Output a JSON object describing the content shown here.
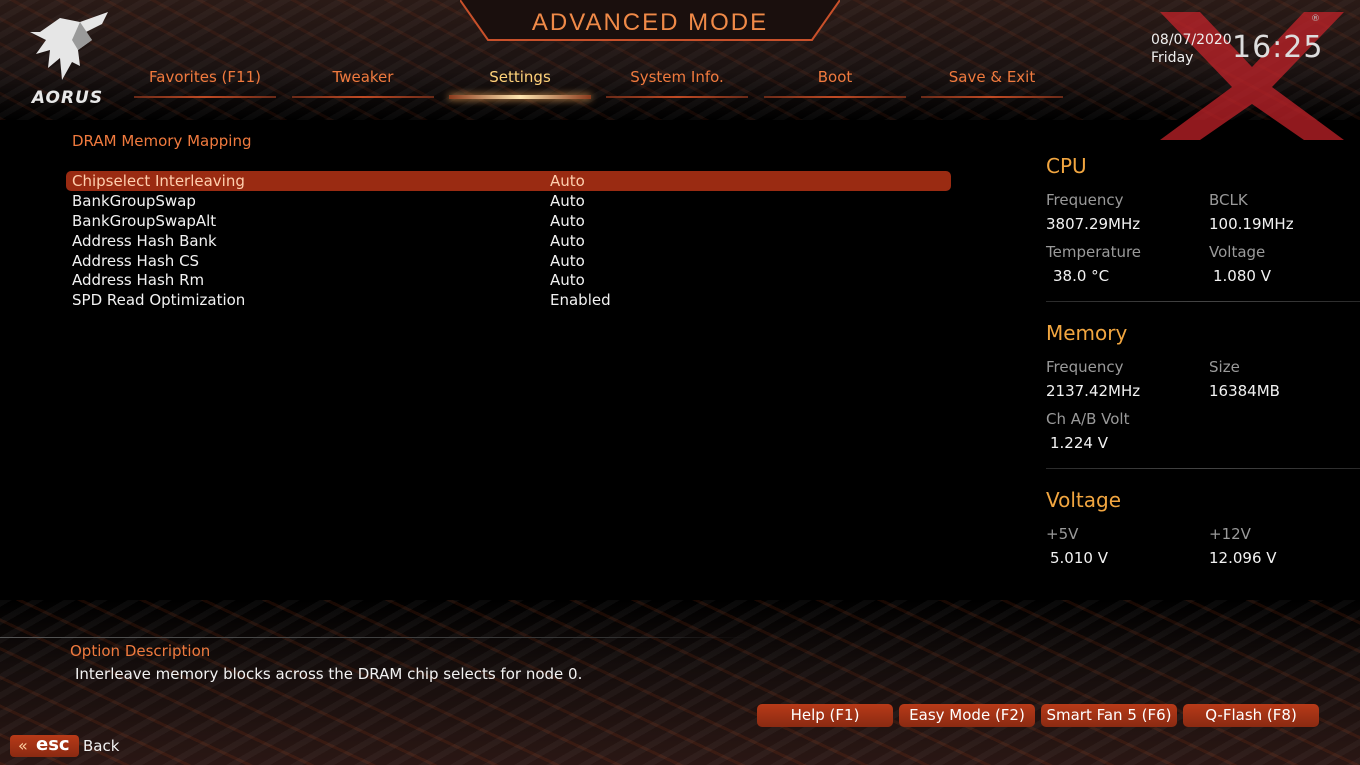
{
  "header": {
    "title": "ADVANCED MODE",
    "logo_text": "AORUS",
    "date": "08/07/2020",
    "day": "Friday",
    "time": "16:25"
  },
  "tabs": [
    {
      "label": "Favorites (F11)"
    },
    {
      "label": "Tweaker"
    },
    {
      "label": "Settings",
      "active": true
    },
    {
      "label": "System Info."
    },
    {
      "label": "Boot"
    },
    {
      "label": "Save & Exit"
    }
  ],
  "main": {
    "section_title": "DRAM Memory Mapping",
    "rows": [
      {
        "name": "Chipselect Interleaving",
        "value": "Auto",
        "selected": true
      },
      {
        "name": "BankGroupSwap",
        "value": "Auto"
      },
      {
        "name": "BankGroupSwapAlt",
        "value": "Auto"
      },
      {
        "name": "Address Hash Bank",
        "value": "Auto"
      },
      {
        "name": "Address Hash CS",
        "value": "Auto"
      },
      {
        "name": "Address Hash Rm",
        "value": "Auto"
      },
      {
        "name": "SPD Read Optimization",
        "value": "Enabled"
      }
    ]
  },
  "hardware": {
    "cpu": {
      "title": "CPU",
      "frequency_label": "Frequency",
      "frequency": "3807.29MHz",
      "bclk_label": "BCLK",
      "bclk": "100.19MHz",
      "temperature_label": "Temperature",
      "temperature": "38.0 °C",
      "voltage_label": "Voltage",
      "voltage": "1.080 V"
    },
    "memory": {
      "title": "Memory",
      "frequency_label": "Frequency",
      "frequency": "2137.42MHz",
      "size_label": "Size",
      "size": "16384MB",
      "chab_label": "Ch A/B Volt",
      "chab": "1.224 V"
    },
    "voltage": {
      "title": "Voltage",
      "p5v_label": "+5V",
      "p5v": "5.010 V",
      "p12v_label": "+12V",
      "p12v": "12.096 V"
    }
  },
  "description": {
    "title": "Option Description",
    "text": "Interleave memory blocks across the DRAM chip selects for node 0."
  },
  "footer": {
    "buttons": [
      {
        "label": "Help (F1)"
      },
      {
        "label": "Easy Mode (F2)"
      },
      {
        "label": "Smart Fan 5 (F6)"
      },
      {
        "label": "Q-Flash (F8)"
      }
    ],
    "esc_label": "esc",
    "back_label": "Back"
  },
  "colors": {
    "accent_orange": "#f07a3e",
    "hw_title_gold": "#f2a640",
    "selected_row": "#9a2b12",
    "button_red": "#b83a18"
  }
}
